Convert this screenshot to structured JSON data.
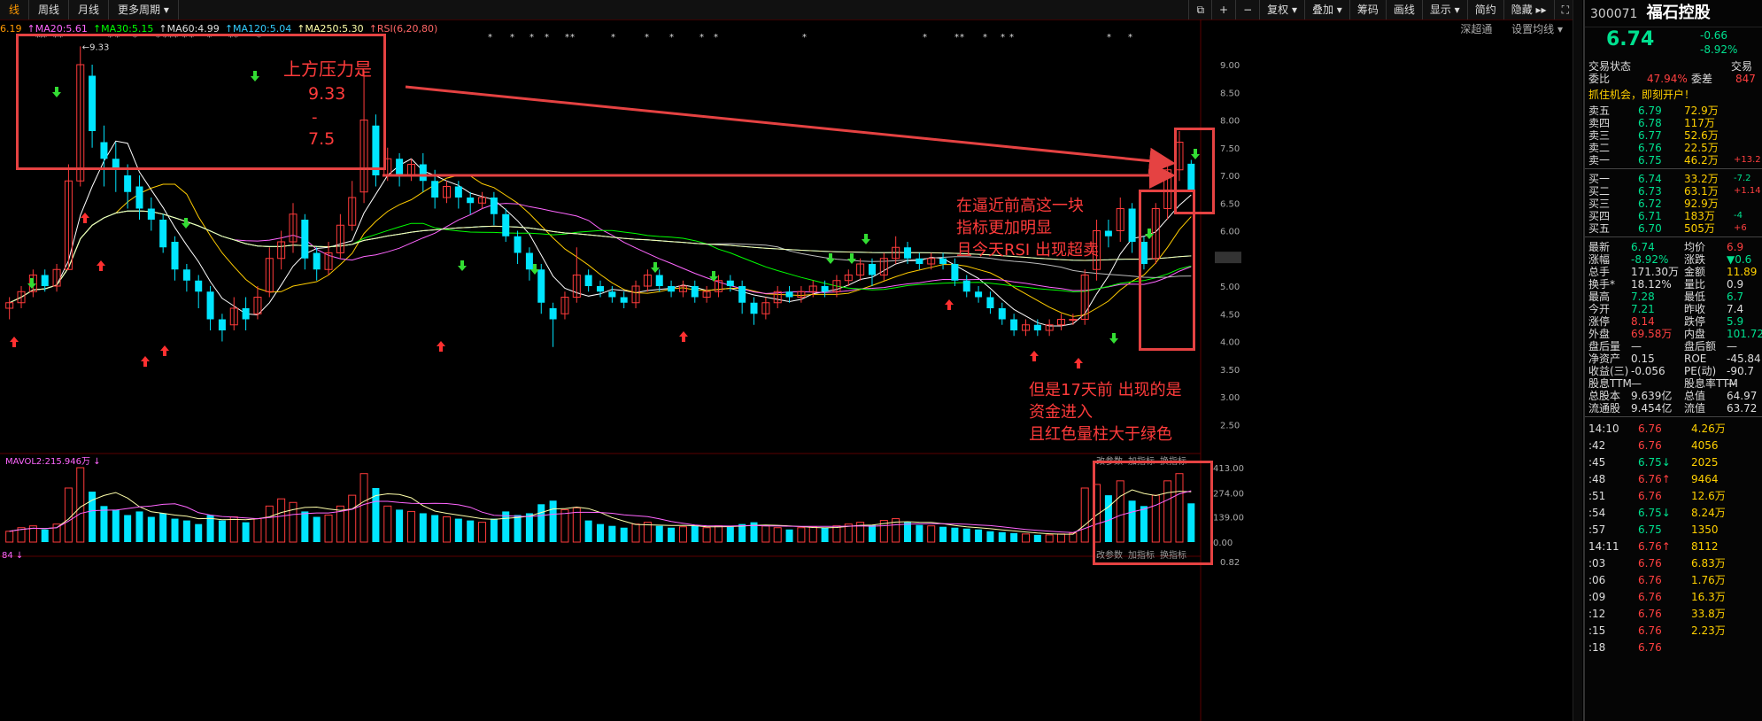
{
  "toolbar": {
    "tabs": [
      "线",
      "周线",
      "月线",
      "更多周期 ▾"
    ],
    "active_tab": 0,
    "right_buttons": [
      "⧉",
      "+",
      "−",
      "复权 ▾",
      "叠加 ▾",
      "筹码",
      "画线",
      "显示 ▾",
      "简约",
      "隐藏 ▸▸",
      "⛶"
    ]
  },
  "indicators": [
    {
      "text": "6.19",
      "color": "#ff9900"
    },
    {
      "text": "↑MA20:5.61",
      "color": "#ff66ff"
    },
    {
      "text": "↑MA30:5.15",
      "color": "#00ff00"
    },
    {
      "text": "↑MA60:4.99",
      "color": "#dddddd"
    },
    {
      "text": "↑MA120:5.04",
      "color": "#33ccff"
    },
    {
      "text": "↑MA250:5.30",
      "color": "#ffffaa"
    },
    {
      "text": "↑RSI(6,20,80)",
      "color": "#ff6666"
    }
  ],
  "subright": [
    "深超通",
    "设置均线 ▾"
  ],
  "price_axis": [
    "9.00",
    "8.50",
    "8.00",
    "7.50",
    "7.00",
    "6.50",
    "6.00",
    "5.51",
    "5.00",
    "4.50",
    "4.00",
    "3.50",
    "3.00",
    "2.50"
  ],
  "vol_axis": [
    "413.00",
    "274.00",
    "139.00",
    "0.00",
    "0.82"
  ],
  "high_label": "←9.33",
  "vol_header": "MAVOL2:215.946万 ↓",
  "vol_buttons": [
    "改参数",
    "加指标",
    "换指标"
  ],
  "vol_footer": [
    "84 ↓"
  ],
  "annotations": {
    "a1_title": "上方压力是",
    "a1_v1": "9.33",
    "a1_dash": "-",
    "a1_v2": "7.5",
    "a2_l1": "在逼近前高这一块",
    "a2_l2": "指标更加明显",
    "a2_l3": "且今天RSI 出现超卖",
    "a3_l1": "但是17天前 出现的是",
    "a3_l2": "资金进入",
    "a3_l3": "且红色量柱大于绿色"
  },
  "stock": {
    "code": "300071",
    "name": "福石控股",
    "price": "6.74",
    "change": "-0.66",
    "change_pct": "-8.92%",
    "status_label": "交易状态",
    "status_value": "交易",
    "weibi_label": "委比",
    "weibi": "47.94%",
    "weicha_label": "委差",
    "weicha": "847",
    "promo": "抓住机会，即刻开户！"
  },
  "asks": [
    {
      "label": "卖五",
      "price": "6.79",
      "vol": "72.9万",
      "delta": ""
    },
    {
      "label": "卖四",
      "price": "6.78",
      "vol": "117万",
      "delta": ""
    },
    {
      "label": "卖三",
      "price": "6.77",
      "vol": "52.6万",
      "delta": ""
    },
    {
      "label": "卖二",
      "price": "6.76",
      "vol": "22.5万",
      "delta": ""
    },
    {
      "label": "卖一",
      "price": "6.75",
      "vol": "46.2万",
      "delta": "+13.2"
    }
  ],
  "bids": [
    {
      "label": "买一",
      "price": "6.74",
      "vol": "33.2万",
      "delta": "-7.2"
    },
    {
      "label": "买二",
      "price": "6.73",
      "vol": "63.1万",
      "delta": "+1.14"
    },
    {
      "label": "买三",
      "price": "6.72",
      "vol": "92.9万",
      "delta": ""
    },
    {
      "label": "买四",
      "price": "6.71",
      "vol": "183万",
      "delta": "-4"
    },
    {
      "label": "买五",
      "price": "6.70",
      "vol": "505万",
      "delta": "+6"
    }
  ],
  "stats": [
    {
      "k1": "最新",
      "v1": "6.74",
      "c1": "g",
      "k2": "均价",
      "v2": "6.9",
      "c2": "r"
    },
    {
      "k1": "涨幅",
      "v1": "-8.92%",
      "c1": "g",
      "k2": "涨跌",
      "v2": "▼0.6",
      "c2": "g"
    },
    {
      "k1": "总手",
      "v1": "171.30万",
      "c1": "w",
      "k2": "金额",
      "v2": "11.89",
      "c2": "y"
    },
    {
      "k1": "换手*",
      "v1": "18.12%",
      "c1": "w",
      "k2": "量比",
      "v2": "0.9",
      "c2": "w"
    },
    {
      "k1": "最高",
      "v1": "7.28",
      "c1": "g",
      "k2": "最低",
      "v2": "6.7",
      "c2": "g"
    },
    {
      "k1": "今开",
      "v1": "7.21",
      "c1": "g",
      "k2": "昨收",
      "v2": "7.4",
      "c2": "w"
    },
    {
      "k1": "涨停",
      "v1": "8.14",
      "c1": "r",
      "k2": "跌停",
      "v2": "5.9",
      "c2": "g"
    },
    {
      "k1": "外盘",
      "v1": "69.58万",
      "c1": "r",
      "k2": "内盘",
      "v2": "101.72",
      "c2": "g"
    },
    {
      "k1": "盘后量",
      "v1": "—",
      "c1": "w",
      "k2": "盘后额",
      "v2": "—",
      "c2": "w"
    },
    {
      "k1": "净资产",
      "v1": "0.15",
      "c1": "w",
      "k2": "ROE",
      "v2": "-45.84",
      "c2": "w"
    },
    {
      "k1": "收益(三)",
      "v1": "-0.056",
      "c1": "w",
      "k2": "PE(动)",
      "v2": "-90.7",
      "c2": "w"
    },
    {
      "k1": "股息TTM",
      "v1": "—",
      "c1": "w",
      "k2": "股息率TTM",
      "v2": "—",
      "c2": "w"
    },
    {
      "k1": "总股本",
      "v1": "9.639亿",
      "c1": "w",
      "k2": "总值",
      "v2": "64.97",
      "c2": "w"
    },
    {
      "k1": "流通股",
      "v1": "9.454亿",
      "c1": "w",
      "k2": "流值",
      "v2": "63.72",
      "c2": "w"
    }
  ],
  "ticks": [
    {
      "t": "14:10",
      "p": "6.76",
      "v": "4.26万",
      "c": "r"
    },
    {
      "t": ":42",
      "p": "6.76",
      "v": "4056",
      "c": "r"
    },
    {
      "t": ":45",
      "p": "6.75↓",
      "v": "2025",
      "c": "g"
    },
    {
      "t": ":48",
      "p": "6.76↑",
      "v": "9464",
      "c": "r"
    },
    {
      "t": ":51",
      "p": "6.76",
      "v": "12.6万",
      "c": "r"
    },
    {
      "t": ":54",
      "p": "6.75↓",
      "v": "8.24万",
      "c": "g"
    },
    {
      "t": ":57",
      "p": "6.75",
      "v": "1350",
      "c": "g"
    },
    {
      "t": "14:11",
      "p": "6.76↑",
      "v": "8112",
      "c": "r"
    },
    {
      "t": ":03",
      "p": "6.76",
      "v": "6.83万",
      "c": "r"
    },
    {
      "t": ":06",
      "p": "6.76",
      "v": "1.76万",
      "c": "r"
    },
    {
      "t": ":09",
      "p": "6.76",
      "v": "16.3万",
      "c": "r"
    },
    {
      "t": ":12",
      "p": "6.76",
      "v": "33.8万",
      "c": "r"
    },
    {
      "t": ":15",
      "p": "6.76",
      "v": "2.23万",
      "c": "r"
    },
    {
      "t": ":18",
      "p": "6.76",
      "v": "",
      "c": "r"
    }
  ],
  "colors": {
    "up": "#ff3b3b",
    "down": "#00e5ff",
    "annot": "#e54242"
  },
  "chart_data": {
    "type": "candlestick",
    "high": 9.33,
    "last_close": 6.74,
    "ylim": [
      2.2,
      9.4
    ],
    "vol_ylim": [
      0,
      413
    ],
    "candles": [
      [
        4.6,
        4.7,
        4.4,
        4.8
      ],
      [
        4.7,
        4.9,
        4.6,
        5.0
      ],
      [
        4.9,
        5.2,
        4.8,
        5.3
      ],
      [
        5.2,
        5.0,
        4.9,
        5.3
      ],
      [
        5.0,
        5.3,
        4.9,
        5.4
      ],
      [
        5.3,
        6.9,
        5.3,
        7.2
      ],
      [
        6.9,
        9.0,
        6.8,
        9.33
      ],
      [
        8.8,
        7.8,
        7.5,
        9.0
      ],
      [
        7.6,
        7.3,
        6.8,
        7.9
      ],
      [
        7.3,
        7.1,
        6.7,
        7.6
      ],
      [
        7.0,
        6.7,
        6.4,
        7.2
      ],
      [
        6.8,
        6.4,
        6.2,
        7.0
      ],
      [
        6.4,
        6.2,
        6.0,
        6.6
      ],
      [
        6.2,
        5.7,
        5.6,
        6.3
      ],
      [
        5.8,
        5.3,
        5.1,
        5.9
      ],
      [
        5.3,
        5.1,
        4.9,
        5.4
      ],
      [
        5.1,
        4.9,
        4.6,
        5.2
      ],
      [
        4.9,
        4.4,
        4.2,
        5.0
      ],
      [
        4.4,
        4.2,
        4.0,
        4.5
      ],
      [
        4.3,
        4.6,
        4.2,
        4.8
      ],
      [
        4.6,
        4.4,
        4.2,
        4.8
      ],
      [
        4.5,
        4.8,
        4.4,
        5.0
      ],
      [
        4.9,
        5.5,
        4.8,
        5.7
      ],
      [
        5.5,
        5.8,
        5.3,
        6.0
      ],
      [
        5.8,
        6.3,
        5.6,
        6.5
      ],
      [
        6.2,
        5.5,
        5.3,
        6.3
      ],
      [
        5.6,
        5.3,
        5.1,
        5.7
      ],
      [
        5.3,
        5.6,
        5.2,
        5.8
      ],
      [
        5.6,
        6.1,
        5.5,
        6.3
      ],
      [
        6.1,
        6.6,
        6.0,
        6.9
      ],
      [
        6.7,
        8.0,
        6.5,
        8.9
      ],
      [
        7.9,
        7.0,
        6.8,
        8.1
      ],
      [
        7.0,
        7.3,
        6.9,
        7.5
      ],
      [
        7.3,
        7.0,
        6.8,
        7.4
      ],
      [
        7.0,
        7.2,
        6.9,
        7.3
      ],
      [
        7.2,
        6.9,
        6.7,
        7.4
      ],
      [
        6.9,
        6.6,
        6.4,
        7.1
      ],
      [
        6.6,
        6.8,
        6.5,
        6.9
      ],
      [
        6.8,
        6.6,
        6.4,
        6.9
      ],
      [
        6.6,
        6.5,
        6.3,
        6.7
      ],
      [
        6.5,
        6.6,
        6.4,
        6.7
      ],
      [
        6.6,
        6.3,
        6.1,
        6.7
      ],
      [
        6.3,
        5.9,
        5.8,
        6.4
      ],
      [
        5.9,
        5.6,
        5.4,
        6.0
      ],
      [
        5.6,
        5.3,
        5.1,
        5.7
      ],
      [
        5.3,
        4.7,
        4.5,
        5.4
      ],
      [
        4.6,
        4.4,
        3.9,
        4.7
      ],
      [
        4.5,
        4.8,
        4.4,
        4.9
      ],
      [
        4.8,
        5.2,
        4.7,
        5.7
      ],
      [
        5.2,
        5.0,
        4.9,
        5.3
      ],
      [
        5.0,
        4.9,
        4.8,
        5.1
      ],
      [
        4.9,
        4.8,
        4.7,
        5.0
      ],
      [
        4.8,
        4.7,
        4.6,
        4.9
      ],
      [
        4.7,
        5.0,
        4.6,
        5.1
      ],
      [
        5.0,
        5.2,
        4.9,
        5.3
      ],
      [
        5.2,
        5.0,
        4.9,
        5.3
      ],
      [
        5.0,
        4.9,
        4.8,
        5.1
      ],
      [
        4.9,
        5.0,
        4.8,
        5.1
      ],
      [
        5.0,
        4.8,
        4.7,
        5.1
      ],
      [
        4.8,
        4.9,
        4.7,
        5.0
      ],
      [
        4.9,
        5.1,
        4.8,
        5.2
      ],
      [
        5.1,
        5.0,
        4.9,
        5.2
      ],
      [
        5.0,
        4.7,
        4.5,
        5.1
      ],
      [
        4.7,
        4.5,
        4.3,
        4.8
      ],
      [
        4.5,
        4.7,
        4.4,
        4.8
      ],
      [
        4.7,
        4.9,
        4.6,
        5.0
      ],
      [
        4.9,
        4.8,
        4.7,
        5.0
      ],
      [
        4.8,
        4.9,
        4.7,
        5.0
      ],
      [
        4.9,
        5.0,
        4.8,
        5.1
      ],
      [
        5.0,
        4.9,
        4.8,
        5.1
      ],
      [
        4.9,
        5.1,
        4.8,
        5.2
      ],
      [
        5.1,
        5.2,
        5.0,
        5.3
      ],
      [
        5.2,
        5.4,
        5.1,
        5.5
      ],
      [
        5.4,
        5.2,
        5.0,
        5.5
      ],
      [
        5.2,
        5.5,
        5.1,
        5.6
      ],
      [
        5.5,
        5.7,
        5.4,
        5.9
      ],
      [
        5.7,
        5.5,
        5.4,
        5.8
      ],
      [
        5.5,
        5.4,
        5.3,
        5.6
      ],
      [
        5.4,
        5.5,
        5.3,
        5.6
      ],
      [
        5.5,
        5.4,
        5.3,
        5.6
      ],
      [
        5.4,
        5.1,
        5.0,
        5.5
      ],
      [
        5.1,
        4.9,
        4.8,
        5.2
      ],
      [
        4.9,
        4.8,
        4.7,
        5.0
      ],
      [
        4.8,
        4.6,
        4.5,
        4.9
      ],
      [
        4.6,
        4.4,
        4.3,
        4.7
      ],
      [
        4.4,
        4.2,
        4.1,
        4.5
      ],
      [
        4.2,
        4.3,
        4.1,
        4.4
      ],
      [
        4.3,
        4.2,
        4.1,
        4.4
      ],
      [
        4.2,
        4.3,
        4.1,
        4.4
      ],
      [
        4.3,
        4.4,
        4.2,
        4.5
      ],
      [
        4.4,
        4.4,
        4.3,
        4.5
      ],
      [
        4.4,
        5.2,
        4.3,
        5.3
      ],
      [
        5.3,
        6.0,
        5.1,
        6.2
      ],
      [
        6.0,
        5.9,
        5.7,
        6.2
      ],
      [
        6.0,
        6.4,
        5.8,
        6.6
      ],
      [
        6.4,
        5.8,
        5.6,
        6.5
      ],
      [
        5.8,
        5.4,
        5.3,
        5.9
      ],
      [
        5.5,
        6.4,
        5.4,
        6.5
      ],
      [
        6.4,
        7.1,
        6.2,
        7.3
      ],
      [
        7.1,
        7.6,
        6.9,
        7.8
      ],
      [
        7.21,
        6.74,
        6.7,
        7.28
      ]
    ],
    "volumes": [
      60,
      80,
      90,
      70,
      100,
      300,
      413,
      280,
      200,
      180,
      150,
      170,
      140,
      160,
      130,
      120,
      100,
      150,
      120,
      140,
      110,
      130,
      200,
      240,
      220,
      170,
      140,
      150,
      200,
      260,
      380,
      300,
      200,
      180,
      170,
      160,
      150,
      140,
      130,
      120,
      110,
      130,
      170,
      150,
      160,
      210,
      230,
      180,
      190,
      120,
      100,
      90,
      80,
      100,
      110,
      90,
      80,
      85,
      90,
      80,
      90,
      85,
      100,
      110,
      90,
      80,
      70,
      80,
      85,
      80,
      90,
      100,
      110,
      95,
      120,
      130,
      110,
      95,
      90,
      85,
      80,
      75,
      70,
      60,
      55,
      50,
      45,
      40,
      40,
      45,
      50,
      300,
      320,
      260,
      340,
      230,
      200,
      260,
      340,
      380,
      215
    ]
  }
}
